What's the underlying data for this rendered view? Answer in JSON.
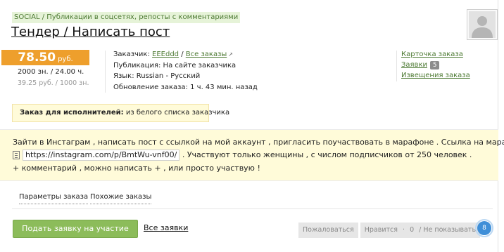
{
  "order": {
    "category": "SOCIAL / Публикации в соцсетях, репосты с комментариями",
    "title": "Тендер / Написать пост",
    "avatar_icon": "user-silhouette-icon"
  },
  "price": {
    "value": "78.50",
    "unit": "руб.",
    "sub_line": "2000 зн. / 24.00 ч.",
    "rate_line": "39.25 руб. / 1000 зн."
  },
  "meta": {
    "customer_label": "Заказчик:",
    "customer_name": "EEEddd",
    "separator": "/",
    "all_orders_link": "Все заказы",
    "publication_label": "Публикация:",
    "publication_value": "На сайте заказчика",
    "language_label": "Язык:",
    "language_value": "Russian - Русский",
    "updated_label": "Обновление заказа:",
    "updated_value": "1 ч. 43 мин. назад"
  },
  "side_links": {
    "order_card": "Карточка заказа",
    "bids": "Заявки",
    "bids_count": "5",
    "notifications": "Извещения заказа"
  },
  "notice": {
    "label": "Заказ для исполнителей:",
    "value": "из белого списка заказчика"
  },
  "description": {
    "line1": "Зайти в Инстаграм , написать пост с ссылкой на мой аккаунт , пригласить поучаствовать в марафоне . Ссылка на марафон",
    "url": "https://instagram.com/p/BmtWu-vnf00/",
    "line2_rest": ". Участвуют только женщины , с числом подписчиков от 250 человек .",
    "line3": "+ комментарий , можно написать + , или просто участвую !"
  },
  "tabs": {
    "params": "Параметры заказа",
    "similar": "Похожие заказы"
  },
  "actions": {
    "apply_button": "Подать заявку на участие",
    "all_bids": "Все заявки",
    "complain": "Пожаловаться",
    "like": "Нравится",
    "like_separator": "·",
    "like_count": "0",
    "hide": "/ Не показывать",
    "bid_counter": "8"
  },
  "colors": {
    "accent_green": "#8cbc5a",
    "price_orange": "#ee9f2c",
    "link_green": "#4d7a33",
    "highlight_yellow": "#fffbd9",
    "badge_blue": "#3f8fd8"
  }
}
